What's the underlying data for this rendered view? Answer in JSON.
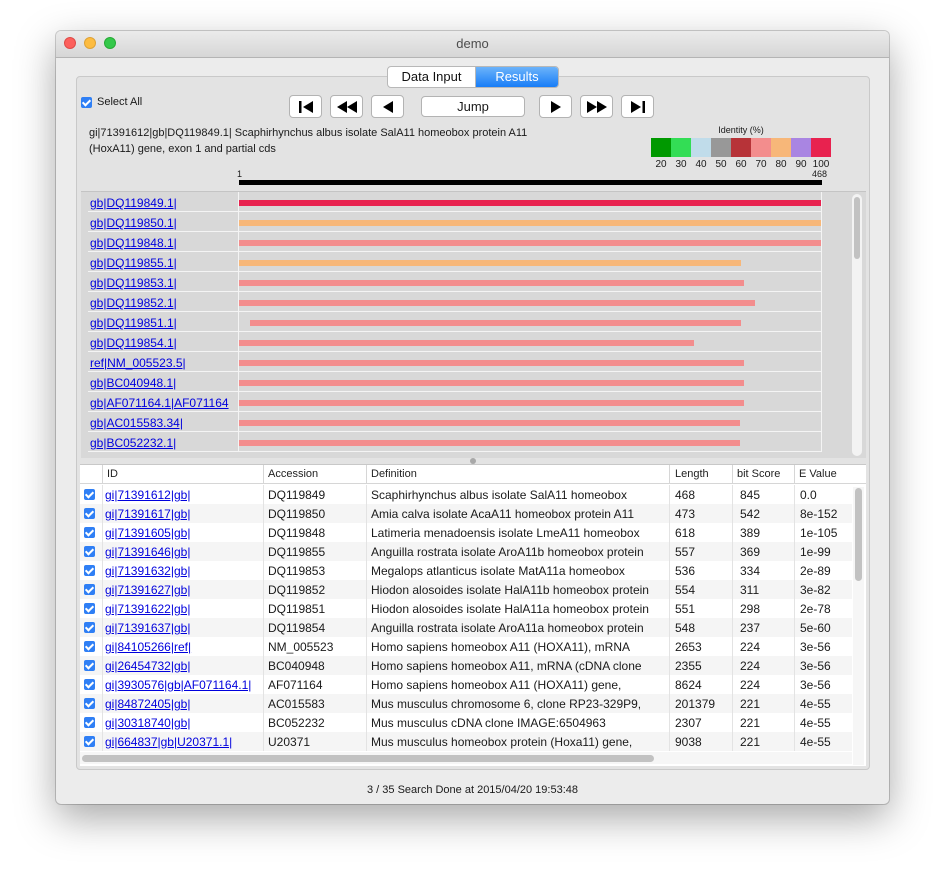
{
  "window": {
    "title": "demo"
  },
  "tabs": {
    "data_input": "Data Input",
    "results": "Results",
    "selected": "Results"
  },
  "select_all": {
    "label": "Select All",
    "checked": true
  },
  "nav": {
    "first_icon": "skip-first-icon",
    "rewind_icon": "rewind-icon",
    "prev_icon": "previous-icon",
    "jump_label": "Jump",
    "next_icon": "next-icon",
    "fastforward_icon": "fast-forward-icon",
    "last_icon": "skip-last-icon"
  },
  "query": {
    "title_line1": "gi|71391612|gb|DQ119849.1| Scaphirhynchus albus isolate SalA11 homeobox protein A11",
    "title_line2": "(HoxA11) gene, exon 1 and partial cds"
  },
  "legend": {
    "title": "Identity (%)",
    "colors": [
      "#009900",
      "#33dd55",
      "#c0dcea",
      "#989898",
      "#b73338",
      "#f38d8d",
      "#f7b779",
      "#a985e2",
      "#e8224f"
    ],
    "labels": [
      "20",
      "30",
      "40",
      "50",
      "60",
      "70",
      "80",
      "90",
      "100"
    ]
  },
  "ruler": {
    "start": "1",
    "end": "468",
    "length": 468
  },
  "graph": {
    "rows": [
      {
        "label": "gb|DQ119849.1|",
        "from": 1,
        "to": 468,
        "color": "#e8224f"
      },
      {
        "label": "gb|DQ119850.1|",
        "from": 1,
        "to": 468,
        "color": "#f7b779"
      },
      {
        "label": "gb|DQ119848.1|",
        "from": 1,
        "to": 468,
        "color": "#f38d8d"
      },
      {
        "label": "gb|DQ119855.1|",
        "from": 1,
        "to": 404,
        "color": "#f7b779"
      },
      {
        "label": "gb|DQ119853.1|",
        "from": 1,
        "to": 406,
        "color": "#f38d8d"
      },
      {
        "label": "gb|DQ119852.1|",
        "from": 1,
        "to": 415,
        "color": "#f38d8d"
      },
      {
        "label": "gb|DQ119851.1|",
        "from": 10,
        "to": 404,
        "color": "#f38d8d"
      },
      {
        "label": "gb|DQ119854.1|",
        "from": 1,
        "to": 366,
        "color": "#f38d8d"
      },
      {
        "label": "ref|NM_005523.5|",
        "from": 1,
        "to": 406,
        "color": "#f38d8d"
      },
      {
        "label": "gb|BC040948.1|",
        "from": 1,
        "to": 406,
        "color": "#f38d8d"
      },
      {
        "label": "gb|AF071164.1|AF071164",
        "from": 1,
        "to": 406,
        "color": "#f38d8d"
      },
      {
        "label": "gb|AC015583.34|",
        "from": 1,
        "to": 403,
        "color": "#f38d8d"
      },
      {
        "label": "gb|BC052232.1|",
        "from": 1,
        "to": 403,
        "color": "#f38d8d"
      }
    ]
  },
  "table": {
    "headers": [
      "ID",
      "Accession",
      "Definition",
      "Length",
      "bit Score",
      "E Value"
    ],
    "rows": [
      {
        "checked": true,
        "id": "gi|71391612|gb|",
        "accession": "DQ119849",
        "definition": "Scaphirhynchus albus isolate SalA11 homeobox",
        "length": "468",
        "bit_score": "845",
        "evalue": "0.0"
      },
      {
        "checked": true,
        "id": "gi|71391617|gb|",
        "accession": "DQ119850",
        "definition": "Amia calva isolate AcaA11 homeobox protein A11",
        "length": "473",
        "bit_score": "542",
        "evalue": "8e-152"
      },
      {
        "checked": true,
        "id": "gi|71391605|gb|",
        "accession": "DQ119848",
        "definition": "Latimeria menadoensis isolate LmeA11 homeobox",
        "length": "618",
        "bit_score": "389",
        "evalue": "1e-105"
      },
      {
        "checked": true,
        "id": "gi|71391646|gb|",
        "accession": "DQ119855",
        "definition": "Anguilla rostrata isolate AroA11b homeobox protein",
        "length": "557",
        "bit_score": "369",
        "evalue": "1e-99"
      },
      {
        "checked": true,
        "id": "gi|71391632|gb|",
        "accession": "DQ119853",
        "definition": "Megalops atlanticus isolate MatA11a homeobox",
        "length": "536",
        "bit_score": "334",
        "evalue": "2e-89"
      },
      {
        "checked": true,
        "id": "gi|71391627|gb|",
        "accession": "DQ119852",
        "definition": "Hiodon alosoides isolate HalA11b homeobox protein",
        "length": "554",
        "bit_score": "311",
        "evalue": "3e-82"
      },
      {
        "checked": true,
        "id": "gi|71391622|gb|",
        "accession": "DQ119851",
        "definition": "Hiodon alosoides isolate HalA11a homeobox protein",
        "length": "551",
        "bit_score": "298",
        "evalue": "2e-78"
      },
      {
        "checked": true,
        "id": "gi|71391637|gb|",
        "accession": "DQ119854",
        "definition": "Anguilla rostrata isolate AroA11a homeobox protein",
        "length": "548",
        "bit_score": "237",
        "evalue": "5e-60"
      },
      {
        "checked": true,
        "id": "gi|84105266|ref|",
        "accession": "NM_005523",
        "definition": "Homo sapiens homeobox A11 (HOXA11), mRNA",
        "length": "2653",
        "bit_score": "224",
        "evalue": "3e-56"
      },
      {
        "checked": true,
        "id": "gi|26454732|gb|",
        "accession": "BC040948",
        "definition": "Homo sapiens homeobox A11, mRNA (cDNA clone",
        "length": "2355",
        "bit_score": "224",
        "evalue": "3e-56"
      },
      {
        "checked": true,
        "id": "gi|3930576|gb|AF071164.1|",
        "accession": "AF071164",
        "definition": "Homo sapiens homeobox A11 (HOXA11) gene,",
        "length": "8624",
        "bit_score": "224",
        "evalue": "3e-56"
      },
      {
        "checked": true,
        "id": "gi|84872405|gb|",
        "accession": "AC015583",
        "definition": "Mus musculus chromosome 6, clone RP23-329P9,",
        "length": "201379",
        "bit_score": "221",
        "evalue": "4e-55"
      },
      {
        "checked": true,
        "id": "gi|30318740|gb|",
        "accession": "BC052232",
        "definition": "Mus musculus cDNA clone IMAGE:6504963",
        "length": "2307",
        "bit_score": "221",
        "evalue": "4e-55"
      },
      {
        "checked": true,
        "id": "gi|664837|gb|U20371.1|",
        "accession": "U20371",
        "definition": "Mus musculus homeobox protein (Hoxa11) gene,",
        "length": "9038",
        "bit_score": "221",
        "evalue": "4e-55"
      }
    ]
  },
  "status": {
    "text": "3 / 35   Search Done at 2015/04/20 19:53:48"
  }
}
